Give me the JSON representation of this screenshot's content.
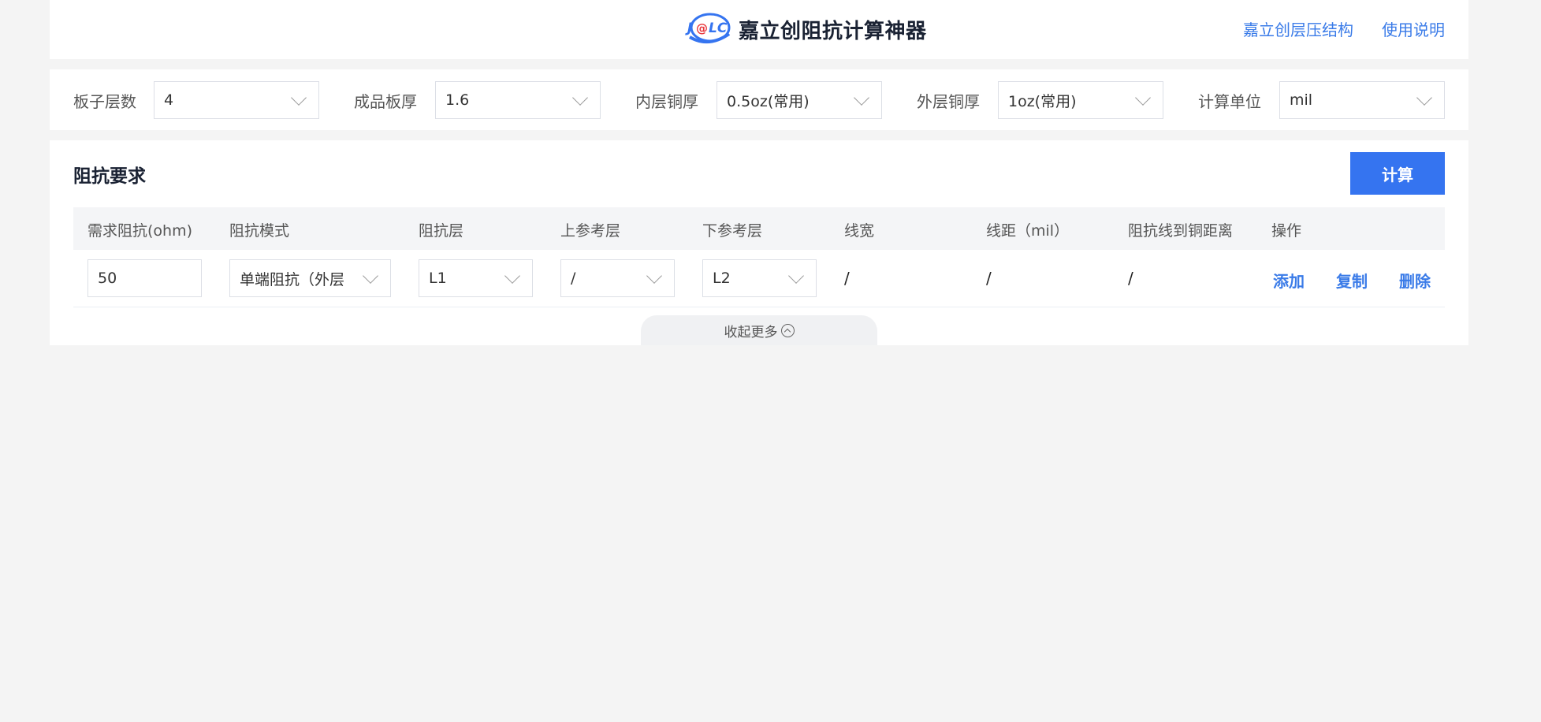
{
  "header": {
    "logo_text": "J@LC",
    "title": "嘉立创阻抗计算神器",
    "links": [
      "嘉立创层压结构",
      "使用说明"
    ]
  },
  "settings": [
    {
      "label": "板子层数",
      "value": "4"
    },
    {
      "label": "成品板厚",
      "value": "1.6"
    },
    {
      "label": "内层铜厚",
      "value": "0.5oz(常用)"
    },
    {
      "label": "外层铜厚",
      "value": "1oz(常用)"
    },
    {
      "label": "计算单位",
      "value": "mil"
    }
  ],
  "panel": {
    "title": "阻抗要求",
    "calc_label": "计算",
    "columns": [
      "需求阻抗(ohm)",
      "阻抗模式",
      "阻抗层",
      "上参考层",
      "下参考层",
      "线宽",
      "线距（mil）",
      "阻抗线到铜距离",
      "操作"
    ],
    "row": {
      "impedance": "50",
      "mode": "单端阻抗（外层",
      "layer": "L1",
      "upper_ref": "/",
      "lower_ref": "L2",
      "line_width": "/",
      "line_spacing": "/",
      "copper_distance": "/",
      "actions": [
        "添加",
        "复制",
        "删除"
      ]
    },
    "collapse_label": "收起更多"
  },
  "colors": {
    "accent": "#3574f0",
    "link": "#3a7be8",
    "logo_red": "#e8363c"
  }
}
